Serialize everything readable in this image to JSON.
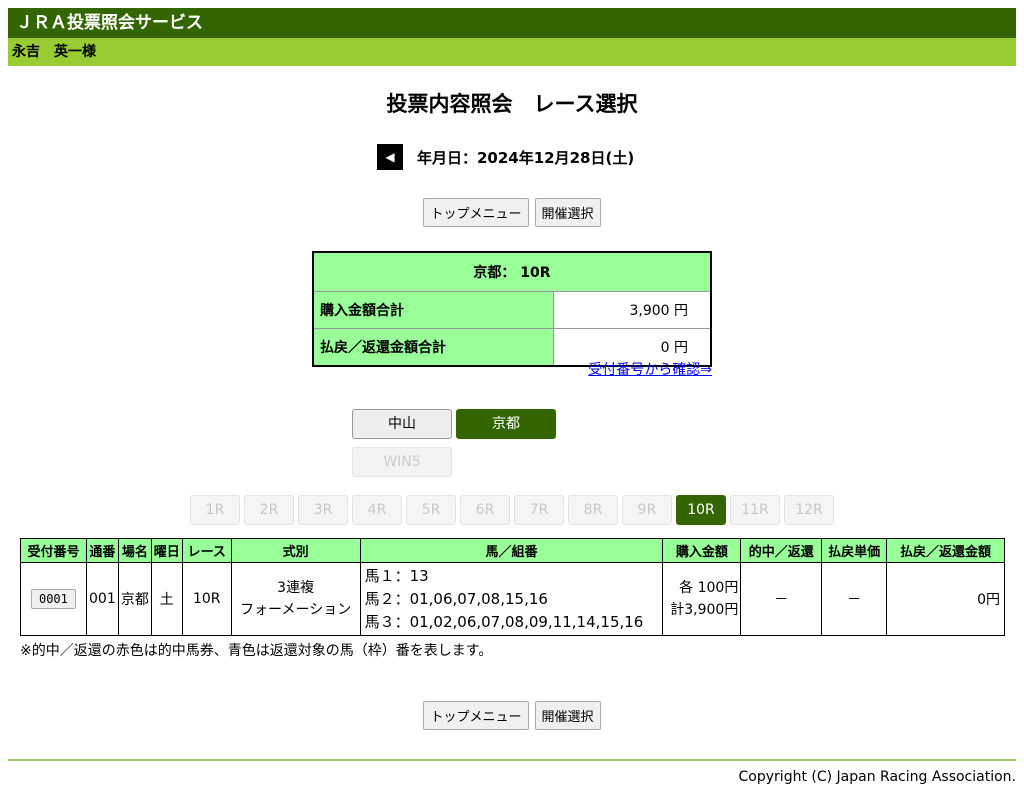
{
  "header": {
    "title": "ＪＲＡ投票照会サービス",
    "user": "永吉　英一様"
  },
  "page": {
    "title": "投票内容照会　レース選択",
    "prev_icon": "left-triangle-icon",
    "date_label": "年月日：2024年12月28日(土)"
  },
  "nav": {
    "top_menu": "トップメニュー",
    "kaisai": "開催選択"
  },
  "summary": {
    "header": "京都：  10R",
    "purchase_label": "購入金額合計",
    "purchase_value": "3,900 円",
    "refund_label": "払戻／返還金額合計",
    "refund_value": "0 円"
  },
  "confirm_link": "受付番号から確認⇒",
  "venues": {
    "nakayama": "中山",
    "kyoto": "京都",
    "win5": "WIN5"
  },
  "races": [
    "1R",
    "2R",
    "3R",
    "4R",
    "5R",
    "6R",
    "7R",
    "8R",
    "9R",
    "10R",
    "11R",
    "12R"
  ],
  "selected_race": "10R",
  "table": {
    "headers": [
      "受付番号",
      "通番",
      "場名",
      "曜日",
      "レース",
      "式別",
      "馬／組番",
      "購入金額",
      "的中／返還",
      "払戻単価",
      "払戻／返還金額"
    ],
    "row": {
      "receipt": "0001",
      "serial": "001",
      "venue": "京都",
      "day": "土",
      "race": "10R",
      "type_line1": "3連複",
      "type_line2": "フォーメーション",
      "horse1": "馬１：13",
      "horse2": "馬２：01,06,07,08,15,16",
      "horse3": "馬３：01,02,06,07,08,09,11,14,15,16",
      "amount_each": "各  100円",
      "amount_total": "計3,900円",
      "hit": "－",
      "unit_price": "－",
      "payout": "0円"
    }
  },
  "note": "※的中／返還の赤色は的中馬券、青色は返還対象の馬（枠）番を表します。",
  "copyright": "Copyright (C) Japan Racing Association."
}
